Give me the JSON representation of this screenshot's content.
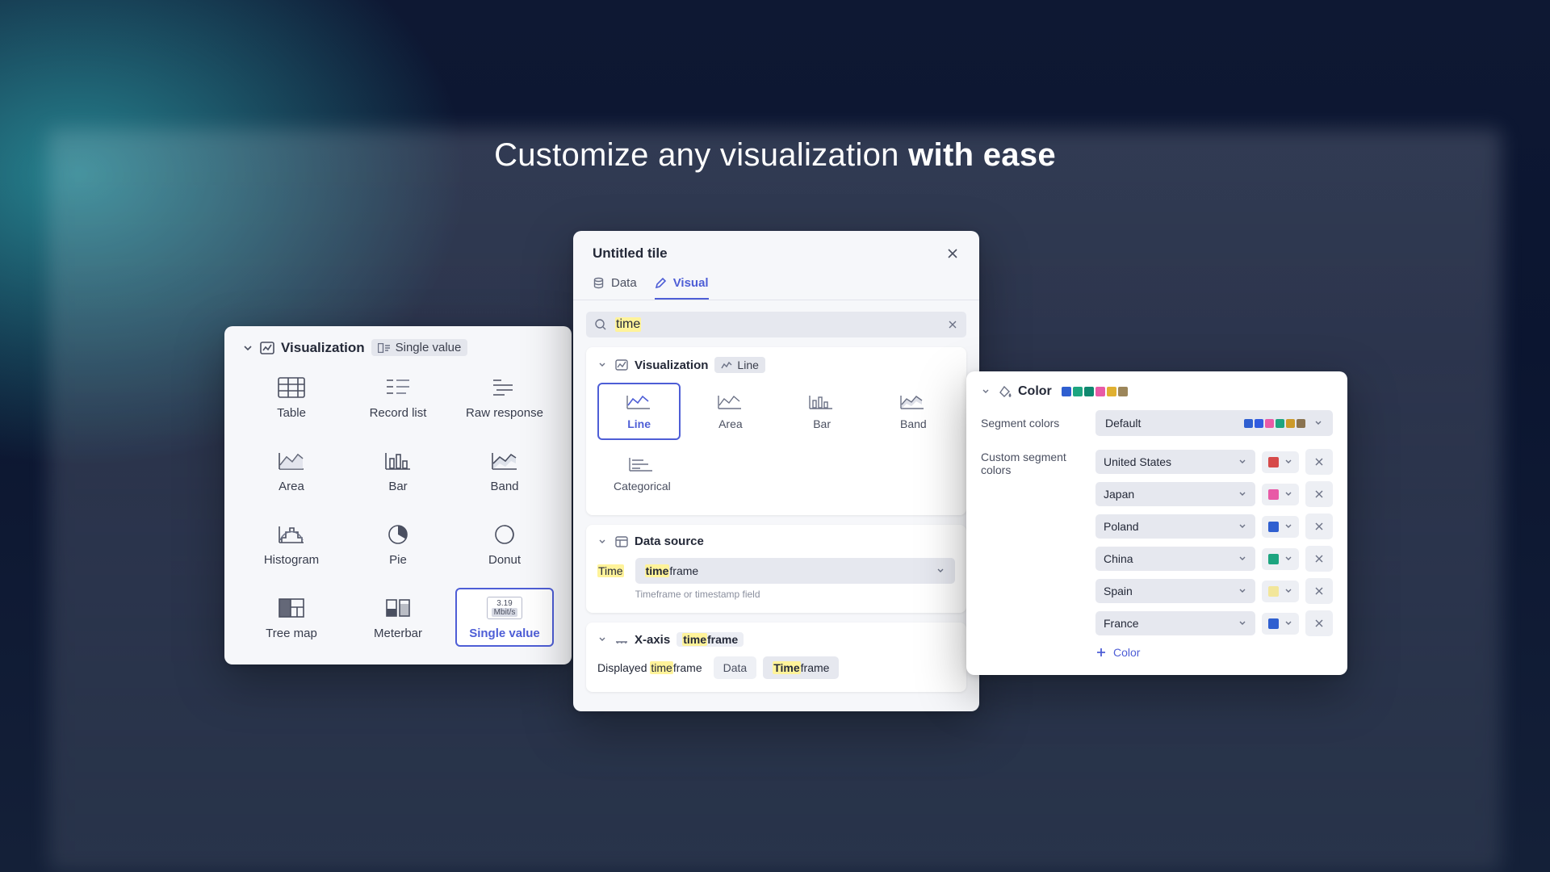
{
  "headline": {
    "pre": "Customize any visualization ",
    "strong": "with ease"
  },
  "viz_panel": {
    "section_label": "Visualization",
    "selected_chip": "Single value",
    "items": [
      {
        "label": "Table"
      },
      {
        "label": "Record list"
      },
      {
        "label": "Raw response"
      },
      {
        "label": "Area"
      },
      {
        "label": "Bar"
      },
      {
        "label": "Band"
      },
      {
        "label": "Histogram"
      },
      {
        "label": "Pie"
      },
      {
        "label": "Donut"
      },
      {
        "label": "Tree map"
      },
      {
        "label": "Meterbar"
      },
      {
        "label": "Single value"
      }
    ],
    "single_value_sample": {
      "number": "3.19",
      "unit": "Mbit/s"
    }
  },
  "modal": {
    "title": "Untitled tile",
    "tabs": {
      "data": "Data",
      "visual": "Visual"
    },
    "search_value": "time",
    "viz": {
      "section_label": "Visualization",
      "selected_chip": "Line",
      "items": [
        {
          "label": "Line"
        },
        {
          "label": "Area"
        },
        {
          "label": "Bar"
        },
        {
          "label": "Band"
        },
        {
          "label": "Categorical"
        }
      ]
    },
    "datasource": {
      "section_label": "Data source",
      "field_label": "Time",
      "select_prefix": "time",
      "select_suffix": "frame",
      "helper": "Timeframe or timestamp field"
    },
    "xaxis": {
      "section_label": "X-axis",
      "chip_prefix": "time",
      "chip_suffix": "frame",
      "displayed_pre": "Displayed ",
      "displayed_hl": "time",
      "displayed_post": "frame",
      "options": {
        "data": "Data",
        "tf_prefix": "Time",
        "tf_suffix": "frame"
      }
    }
  },
  "color_panel": {
    "section_label": "Color",
    "palette_swatches": [
      "#2f5fd0",
      "#1da580",
      "#0f886f",
      "#e85aa6",
      "#e0b030",
      "#9c865a"
    ],
    "segment_colors_label": "Segment colors",
    "segment_default_label": "Default",
    "segment_default_swatches": [
      "#2f5fd0",
      "#315be0",
      "#e85aa6",
      "#1da580",
      "#cc9a2a",
      "#8a7350"
    ],
    "custom_label": "Custom segment colors",
    "countries": [
      {
        "name": "United States",
        "color": "#d64a4a"
      },
      {
        "name": "Japan",
        "color": "#e85aa6"
      },
      {
        "name": "Poland",
        "color": "#2f5fd0"
      },
      {
        "name": "China",
        "color": "#1da580"
      },
      {
        "name": "Spain",
        "color": "#f2e69a"
      },
      {
        "name": "France",
        "color": "#2f5fd0"
      }
    ],
    "add_label": "Color"
  }
}
